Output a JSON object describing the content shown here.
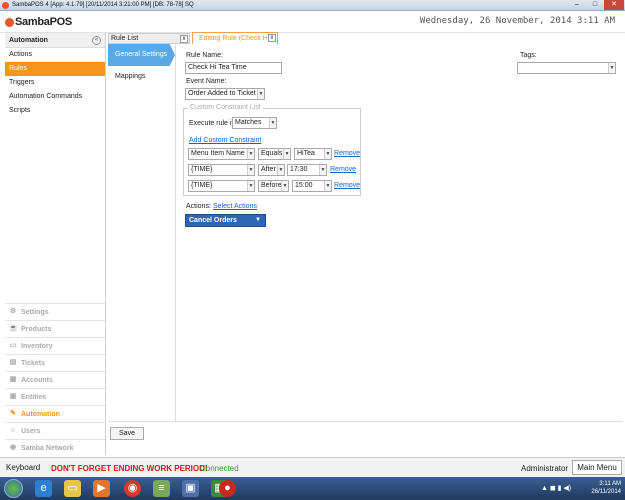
{
  "window": {
    "title": "SambaPOS 4 [App: 4.1.79] [20/11/2014 3:21:00 PM] [DB: 78-78] SQ",
    "minimize": "–",
    "maximize": "□",
    "close": "✕"
  },
  "header": {
    "logo": "SambaPOS",
    "datetime": "Wednesday, 26 November, 2014 3:11 AM"
  },
  "sidebar": {
    "title": "Automation",
    "items": [
      {
        "label": "Actions"
      },
      {
        "label": "Rules"
      },
      {
        "label": "Triggers"
      },
      {
        "label": "Automation Commands"
      },
      {
        "label": "Scripts"
      }
    ],
    "modules": [
      {
        "label": "Settings",
        "icon": "⚙"
      },
      {
        "label": "Products",
        "icon": "☕"
      },
      {
        "label": "Inventory",
        "icon": "▭"
      },
      {
        "label": "Tickets",
        "icon": "▤"
      },
      {
        "label": "Accounts",
        "icon": "▦"
      },
      {
        "label": "Entities",
        "icon": "▣"
      },
      {
        "label": "Automation",
        "icon": "✎"
      },
      {
        "label": "Users",
        "icon": "☺"
      },
      {
        "label": "Samba Network",
        "icon": "◉"
      }
    ]
  },
  "tabs": {
    "rule_list": "Rule List",
    "editing": "Editing Rule (Check Hi",
    "close": "x"
  },
  "subnav": {
    "general": "General Settings",
    "mappings": "Mappings"
  },
  "form": {
    "rule_name_label": "Rule Name:",
    "rule_name_value": "Check Hi Tea Time",
    "tags_label": "Tags:",
    "tags_value": "",
    "event_name_label": "Event Name:",
    "event_name_value": "Order Added to Ticket",
    "constraint_group_title": "Custom Constraint List",
    "execute_label": "Execute rule if",
    "execute_value": "Matches",
    "add_constraint": "Add Custom Constraint",
    "constraints": [
      {
        "field": "Menu Item Name",
        "op": "Equals",
        "value": "HiTea",
        "remove": "Remove"
      },
      {
        "field": "{TIME}",
        "op": "After",
        "value": "17:30",
        "remove": "Remove"
      },
      {
        "field": "{TIME}",
        "op": "Before",
        "value": "15:00",
        "remove": "Remove"
      }
    ],
    "actions_label": "Actions:",
    "select_actions": "Select Actions",
    "action_value": "Cancel Orders",
    "save": "Save"
  },
  "statusbar": {
    "keyboard": "Keyboard",
    "warning": "DON'T FORGET ENDING WORK PERIOD!",
    "connected": "Connected",
    "user": "Administrator",
    "main_menu": "Main Menu"
  },
  "taskbar": {
    "time": "3:11 AM",
    "date": "26/11/2014"
  }
}
